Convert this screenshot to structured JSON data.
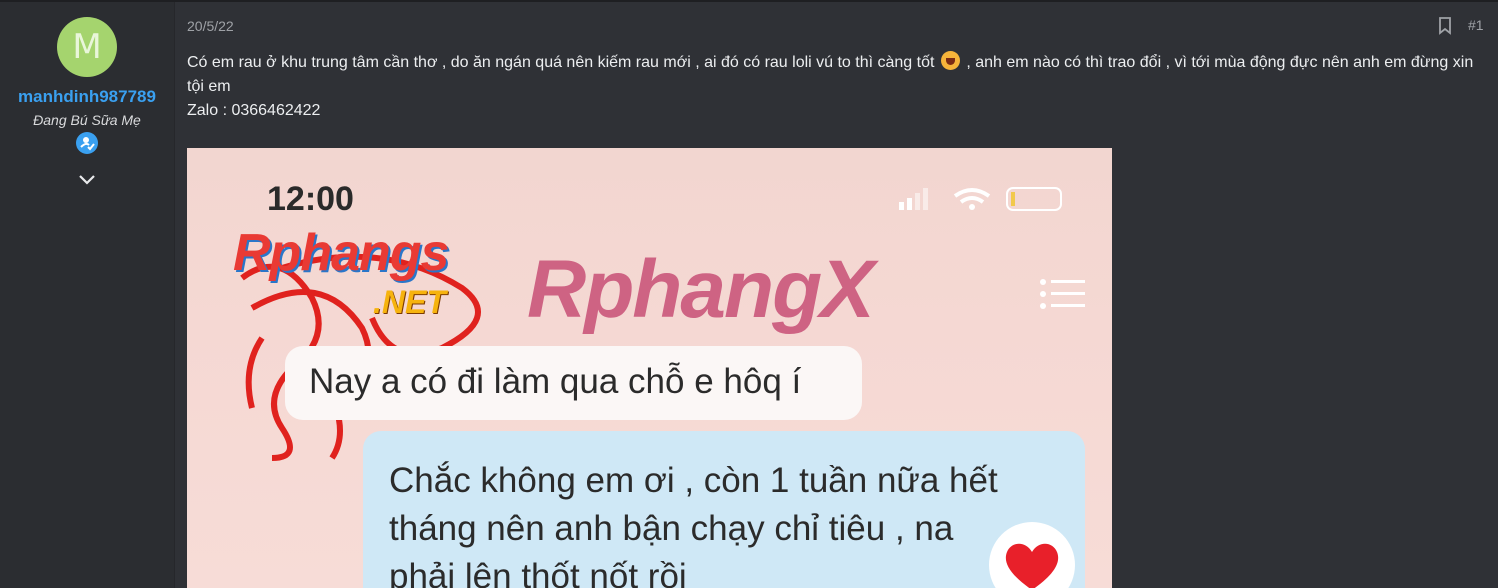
{
  "user": {
    "avatar_letter": "M",
    "username": "manhdinh987789",
    "title": "Đang Bú Sữa Mẹ"
  },
  "post": {
    "date": "20/5/22",
    "number": "#1",
    "text_part1": "Có em rau ở khu trung tâm cần thơ , do ăn ngán quá nên kiếm rau mới , ai đó có rau loli vú to thì càng tốt",
    "text_part2": " , anh em nào có thì trao đổi , vì tới mùa động đực nên anh em đừng xin tội em",
    "contact": "Zalo : 0366462422"
  },
  "image": {
    "clock": "12:00",
    "watermark_main": "Rphangs",
    "watermark_sub": ".NET",
    "watermark_center": "RphangX",
    "chat_incoming": "Nay a có đi làm qua chỗ e hôq í",
    "chat_outgoing_line1": "Chắc không em ơi , còn 1 tuần nữa hết",
    "chat_outgoing_line2": "tháng nên anh bận chạy chỉ tiêu , na",
    "chat_outgoing_line3": "phải lên thốt nốt rồi"
  },
  "icons": {
    "verified": "verified-user-icon",
    "expand": "chevron-down-icon",
    "bookmark": "bookmark-icon",
    "emoji": "shouting-face-emoji-icon"
  },
  "colors": {
    "accent": "#3aa0f0",
    "avatar_bg": "#a5d46e",
    "background": "#2f3136"
  }
}
